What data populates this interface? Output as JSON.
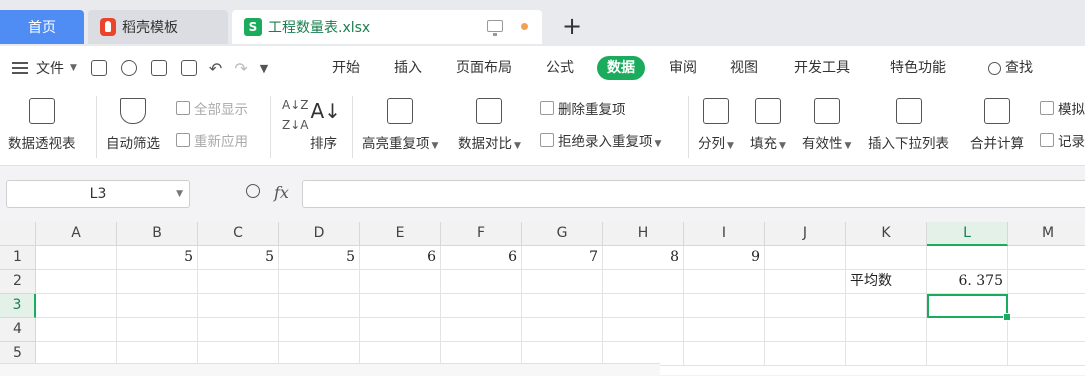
{
  "tabs": {
    "home": "首页",
    "template": "稻壳模板",
    "file": "工程数量表.xlsx",
    "file_icon_letter": "S"
  },
  "menu": {
    "file": "文件",
    "items": [
      "开始",
      "插入",
      "页面布局",
      "公式",
      "数据",
      "审阅",
      "视图",
      "开发工具",
      "特色功能"
    ],
    "search": "查找",
    "active": "数据"
  },
  "ribbon": {
    "pivot": "数据透视表",
    "autofilter": "自动筛选",
    "show_all": "全部显示",
    "reapply": "重新应用",
    "sort": "排序",
    "highlight_dup": "高亮重复项",
    "data_compare": "数据对比",
    "delete_dup": "删除重复项",
    "reject_dup": "拒绝录入重复项",
    "split": "分列",
    "fill": "填充",
    "validity": "有效性",
    "insert_dropdown": "插入下拉列表",
    "consolidate": "合并计算",
    "mock": "模拟",
    "record": "记录"
  },
  "formula": {
    "cell_ref": "L3",
    "fx": "fx",
    "value": ""
  },
  "sheet": {
    "columns": [
      "A",
      "B",
      "C",
      "D",
      "E",
      "F",
      "G",
      "H",
      "I",
      "J",
      "K",
      "L",
      "M"
    ],
    "rows": [
      "1",
      "2",
      "3",
      "4",
      "5"
    ],
    "cells": {
      "B1": "5",
      "C1": "5",
      "D1": "5",
      "E1": "6",
      "F1": "6",
      "G1": "7",
      "H1": "8",
      "I1": "9",
      "K2": "平均数",
      "L2": "6. 375"
    },
    "selected": "L3"
  },
  "colors": {
    "accent": "#1aab5d",
    "home_tab": "#4f8df5"
  }
}
